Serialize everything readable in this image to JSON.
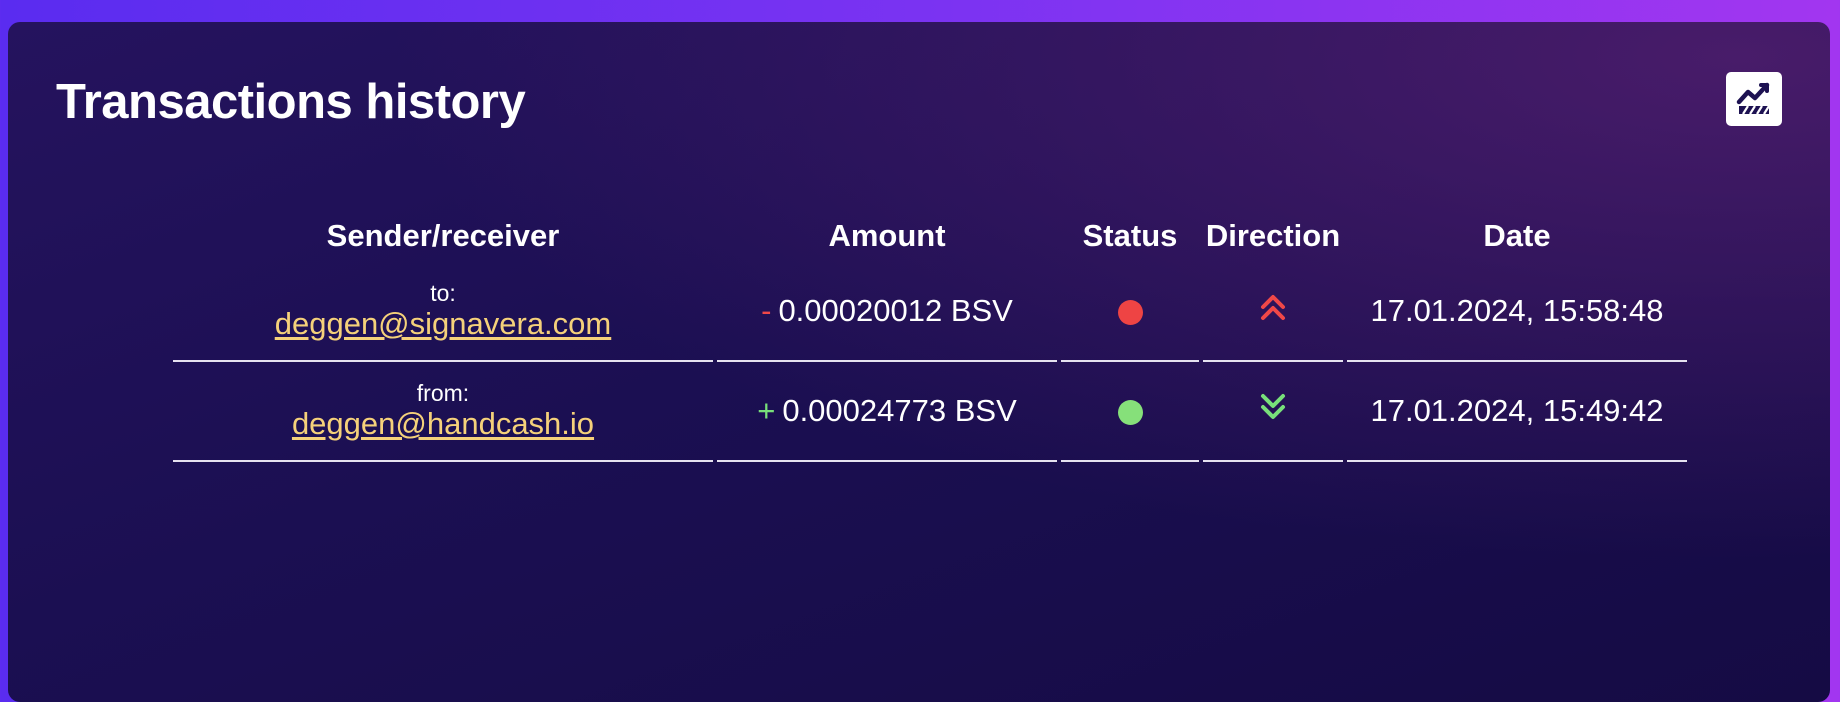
{
  "header": {
    "title": "Transactions history",
    "chart_button_icon": "chart-icon"
  },
  "table": {
    "columns": [
      "Sender/receiver",
      "Amount",
      "Status",
      "Direction",
      "Date"
    ],
    "rows": [
      {
        "party_label": "to:",
        "party": "deggen@signavera.com",
        "sign": "-",
        "amount": "0.00020012 BSV",
        "status_color": "#ee4444",
        "direction": "outgoing",
        "direction_icon": "double-chevron-up-icon",
        "direction_color": "#f04848",
        "date": "17.01.2024, 15:58:48"
      },
      {
        "party_label": "from:",
        "party": "deggen@handcash.io",
        "sign": "+",
        "amount": "0.00024773 BSV",
        "status_color": "#86e07a",
        "direction": "incoming",
        "direction_icon": "double-chevron-down-icon",
        "direction_color": "#78e07a",
        "date": "17.01.2024, 15:49:42"
      }
    ]
  },
  "colors": {
    "link": "#f5d17a",
    "negative": "#f04848",
    "positive": "#78e07a"
  }
}
